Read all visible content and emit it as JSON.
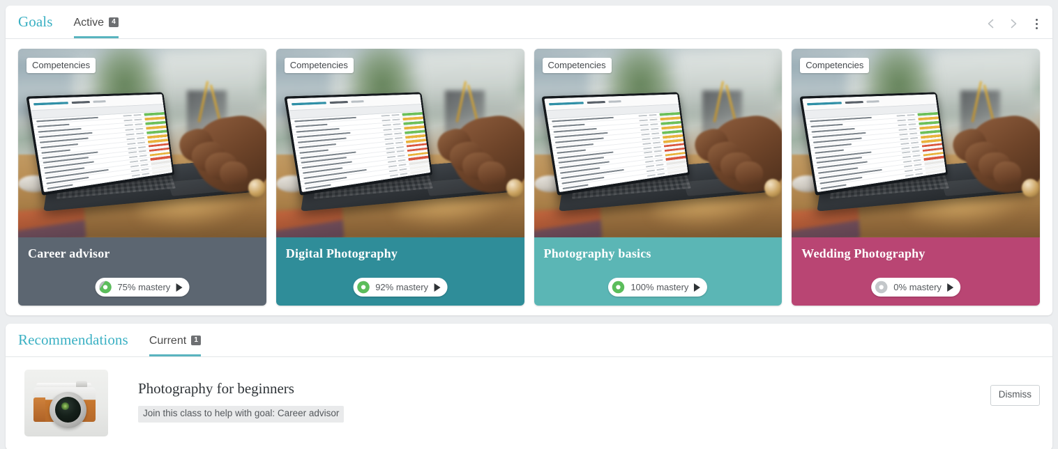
{
  "goals_panel": {
    "section_title": "Goals",
    "tab": {
      "label": "Active",
      "badge": "4"
    },
    "nav": {
      "prev_icon": "chevron-left-icon",
      "next_icon": "chevron-right-icon",
      "menu_icon": "kebab-menu-icon"
    },
    "cards": [
      {
        "category": "Competencies",
        "title": "Career advisor",
        "mastery_label": "75% mastery",
        "mastery_percent": 75,
        "footer_color": "#5c6671",
        "donut_color": "#5bbd5b",
        "play_icon": "play-triangle-icon"
      },
      {
        "category": "Competencies",
        "title": "Digital Photography",
        "mastery_label": "92% mastery",
        "mastery_percent": 92,
        "footer_color": "#2f8d99",
        "donut_color": "#5bbd5b",
        "play_icon": "play-triangle-icon"
      },
      {
        "category": "Competencies",
        "title": "Photography basics",
        "mastery_label": "100% mastery",
        "mastery_percent": 100,
        "footer_color": "#5bb6b5",
        "donut_color": "#5bbd5b",
        "play_icon": "play-triangle-icon"
      },
      {
        "category": "Competencies",
        "title": "Wedding Photography",
        "mastery_label": "0% mastery",
        "mastery_percent": 0,
        "footer_color": "#b94573",
        "donut_color": "#b8bcbf",
        "play_icon": "play-triangle-icon"
      }
    ]
  },
  "recommendations_panel": {
    "section_title": "Recommendations",
    "tab": {
      "label": "Current",
      "badge": "1"
    },
    "item": {
      "thumbnail": "camera-photo",
      "title": "Photography for beginners",
      "subtitle": "Join this class to help with goal: Career advisor",
      "dismiss_label": "Dismiss"
    }
  },
  "theme": {
    "accent": "#3ab0c3",
    "tab_underline": "#59b4bf",
    "badge_bg": "#6d6f72",
    "page_bg": "#eceef0"
  }
}
